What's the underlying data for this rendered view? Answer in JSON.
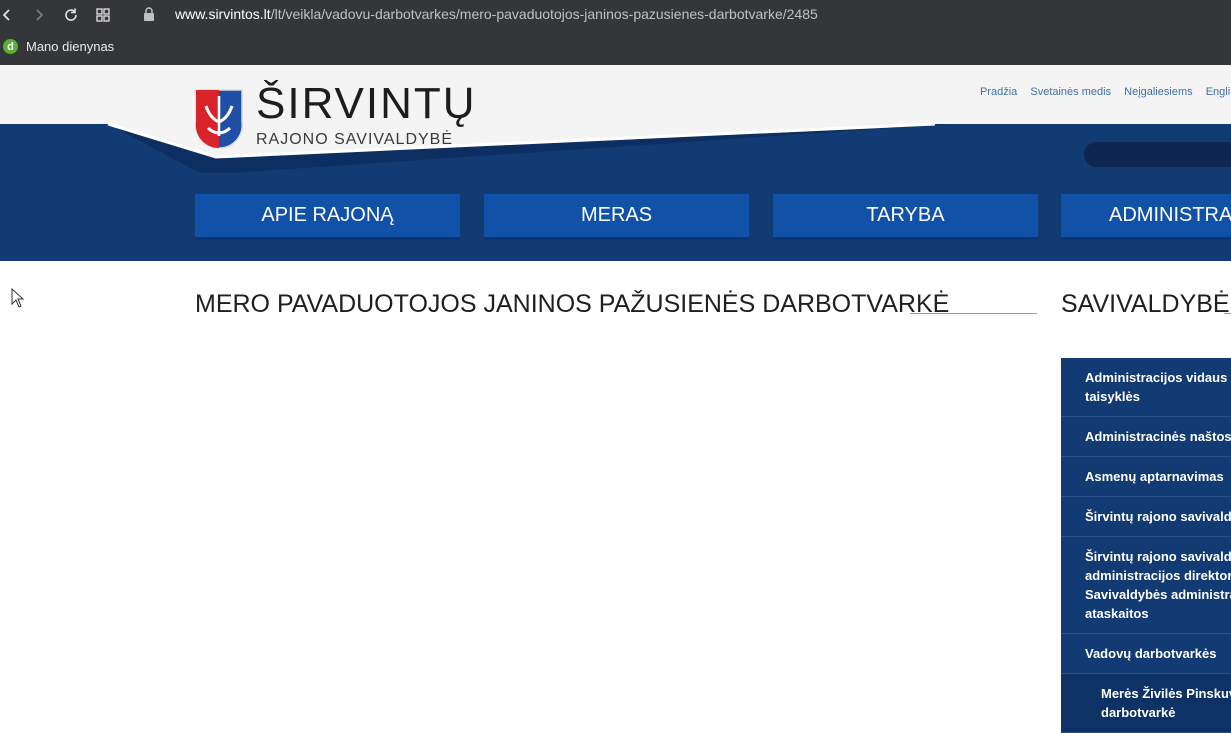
{
  "browser": {
    "url_host": "www.sirvintos.lt",
    "url_path": "/lt/veikla/vadovu-darbotvarkes/mero-pavaduotojos-janinos-pazusienes-darbotvarke/2485",
    "bookmark_icon_letter": "d",
    "bookmark_label": "Mano dienynas"
  },
  "header": {
    "logo_title": "ŠIRVINTŲ",
    "logo_subtitle": "RAJONO SAVIVALDYBĖ",
    "top_links": [
      "Pradžia",
      "Svetainės medis",
      "Neįgaliesiems",
      "Engli"
    ],
    "menu": [
      "APIE RAJONĄ",
      "MERAS",
      "TARYBA",
      "ADMINISTRAC"
    ]
  },
  "content": {
    "page_title": "MERO PAVADUOTOJOS JANINOS PAŽUSIENĖS DARBOTVARKĖ"
  },
  "sidebar": {
    "title": "SAVIVALDYBĖ",
    "items": [
      {
        "lines": [
          "Administracijos vidaus da",
          "taisyklės"
        ]
      },
      {
        "lines": [
          "Administracinės naštos m"
        ]
      },
      {
        "lines": [
          "Asmenų aptarnavimas"
        ]
      },
      {
        "lines": [
          "Širvintų rajono savivaldybė"
        ]
      },
      {
        "lines": [
          "Širvintų rajono savivaldybė",
          "administracijos direktoriau",
          "Savivaldybės administracij",
          "ataskaitos"
        ]
      },
      {
        "lines": [
          "Vadovų darbotvarkės"
        ]
      },
      {
        "lines": [
          "Merės Živilės Pinskuvie",
          "darbotvarkė"
        ]
      }
    ]
  },
  "colors": {
    "brand_blue": "#1152a8",
    "header_navy": "#123a73",
    "chrome_dark": "#35363a"
  }
}
